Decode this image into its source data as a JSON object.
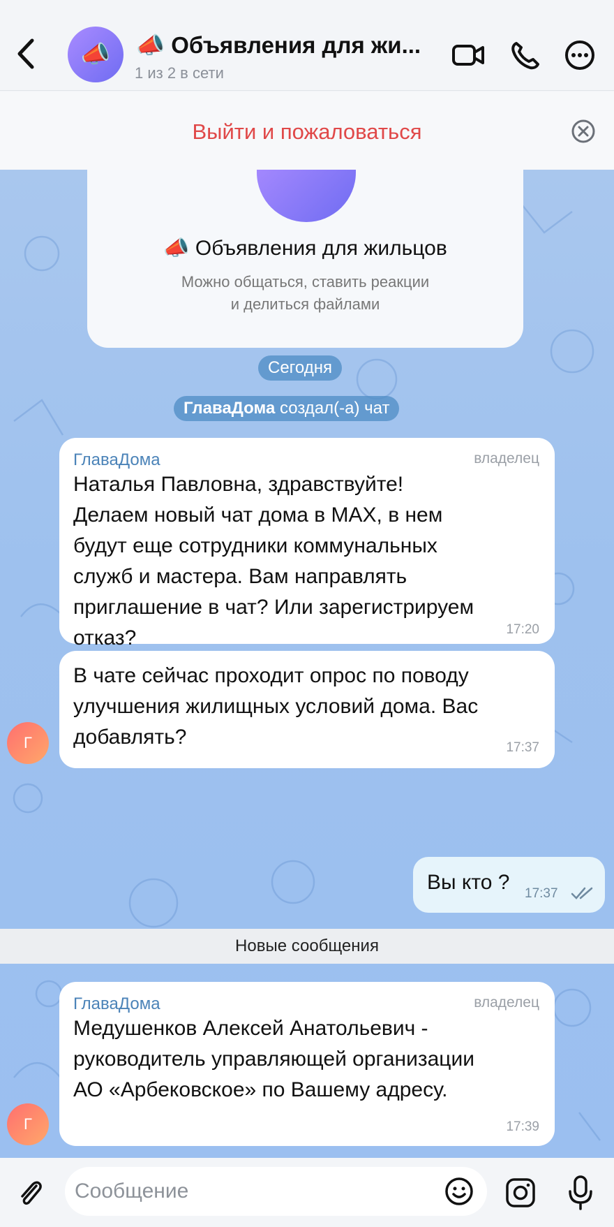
{
  "header": {
    "title": "📣 Объявления для жи...",
    "subtitle": "1 из 2 в сети",
    "avatar_emoji": "📣",
    "icons": [
      "back-icon",
      "video-camera-icon",
      "phone-icon",
      "more-icon"
    ]
  },
  "banner": {
    "action_label": "Выйти и пожаловаться",
    "close_icon": "close-circle-icon"
  },
  "info_card": {
    "title": "📣 Объявления для жильцов",
    "description_line1": "Можно общаться, ставить реакции",
    "description_line2": "и делиться файлами"
  },
  "service": {
    "date_pill": "Сегодня",
    "created_name": "ГлаваДома",
    "created_text": "создал(-а) чат"
  },
  "messages": [
    {
      "sender": "ГлаваДома",
      "role": "владелец",
      "lines": [
        "Наталья Павловна, здравствуйте!",
        "Делаем новый чат дома в MAX, в нем",
        "будут еще сотрудники коммунальных",
        "служб и мастера. Вам направлять",
        "приглашение в чат? Или зарегистрируем",
        "отказ?"
      ],
      "time": "17:20"
    },
    {
      "lines": [
        "В чате сейчас проходит опрос по поводу",
        "улучшения жилищных условий дома. Вас",
        "добавлять?"
      ],
      "time": "17:37",
      "avatar_letter": "Г"
    },
    {
      "outgoing": true,
      "text": "Вы кто ?",
      "time": "17:37",
      "status_icon": "double-check-icon"
    },
    {
      "sender": "ГлаваДома",
      "role": "владелец",
      "lines": [
        "Медушенков Алексей Анатольевич -",
        "руководитель управляющей организации",
        "АО «Арбековское» по Вашему адресу."
      ],
      "time": "17:39",
      "avatar_letter": "Г"
    }
  ],
  "new_messages_label": "Новые сообщения",
  "input": {
    "placeholder": "Сообщение",
    "icons": [
      "paperclip-icon",
      "emoji-icon",
      "camera-icon",
      "microphone-icon"
    ]
  },
  "colors": {
    "accent_red": "#e04848",
    "sender_blue": "#4b83b8",
    "chat_bg": "#a4c4ee",
    "outgoing_bubble": "#e6f4fb"
  }
}
